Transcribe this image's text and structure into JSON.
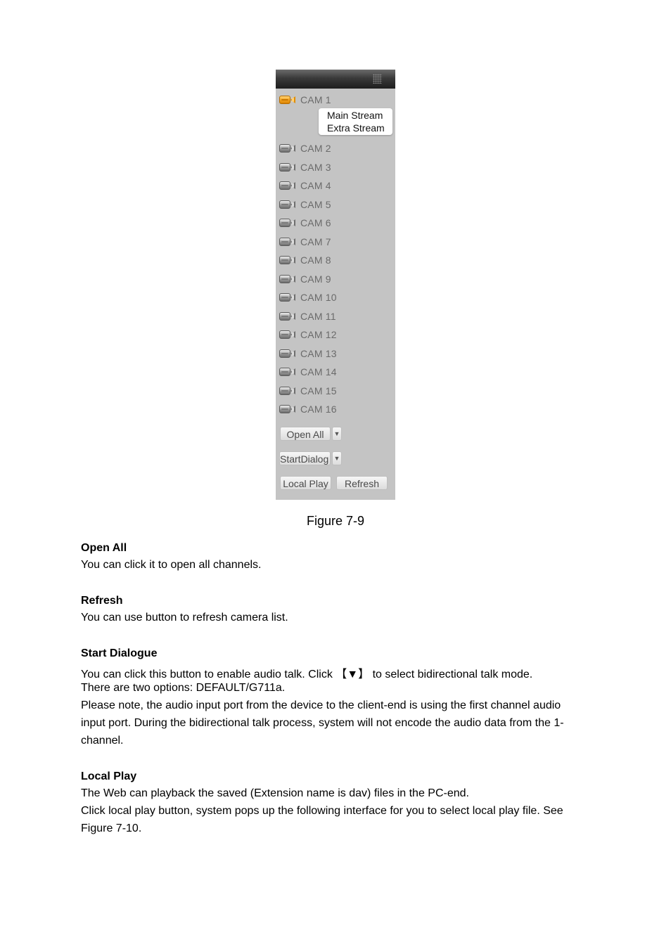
{
  "panel": {
    "cameras": [
      {
        "label": "CAM 1",
        "active": true
      },
      {
        "label": "CAM 2",
        "active": false
      },
      {
        "label": "CAM 3",
        "active": false
      },
      {
        "label": "CAM 4",
        "active": false
      },
      {
        "label": "CAM 5",
        "active": false
      },
      {
        "label": "CAM 6",
        "active": false
      },
      {
        "label": "CAM 7",
        "active": false
      },
      {
        "label": "CAM 8",
        "active": false
      },
      {
        "label": "CAM 9",
        "active": false
      },
      {
        "label": "CAM 10",
        "active": false
      },
      {
        "label": "CAM 11",
        "active": false
      },
      {
        "label": "CAM 12",
        "active": false
      },
      {
        "label": "CAM 13",
        "active": false
      },
      {
        "label": "CAM 14",
        "active": false
      },
      {
        "label": "CAM 15",
        "active": false
      },
      {
        "label": "CAM 16",
        "active": false
      }
    ],
    "stream_menu": [
      "Main Stream",
      "Extra Stream"
    ],
    "buttons": {
      "open_all": "Open All",
      "start_dialog": "StartDialog",
      "local_play": "Local Play",
      "refresh": "Refresh",
      "dropdown_arrow": "▼"
    },
    "colors": {
      "panel_bg": "#c4c4c4",
      "active_camera": "#f5a623"
    }
  },
  "figure_caption": "Figure 7-9",
  "sections": [
    {
      "heading": "Open All",
      "lines": [
        "You can click it to open all channels."
      ]
    },
    {
      "heading": "Refresh",
      "lines": [
        "You can use button to refresh camera list."
      ]
    },
    {
      "heading": "Start Dialogue",
      "lines": [
        "You can click this button to enable audio talk. Click 【▼】 to select bidirectional talk mode.",
        "There are two options: DEFAULT/G711a.",
        "Please note, the audio input port from the device to the client-end is using the first channel audio",
        "input port. During the bidirectional talk process, system will not encode the audio data from the 1-",
        "channel."
      ]
    },
    {
      "heading": "Local Play",
      "lines": [
        "The Web can playback the saved (Extension name is dav) files in the PC-end.",
        "Click local play button, system pops up the following interface for you to select local play file. See",
        "Figure 7-10."
      ]
    }
  ]
}
